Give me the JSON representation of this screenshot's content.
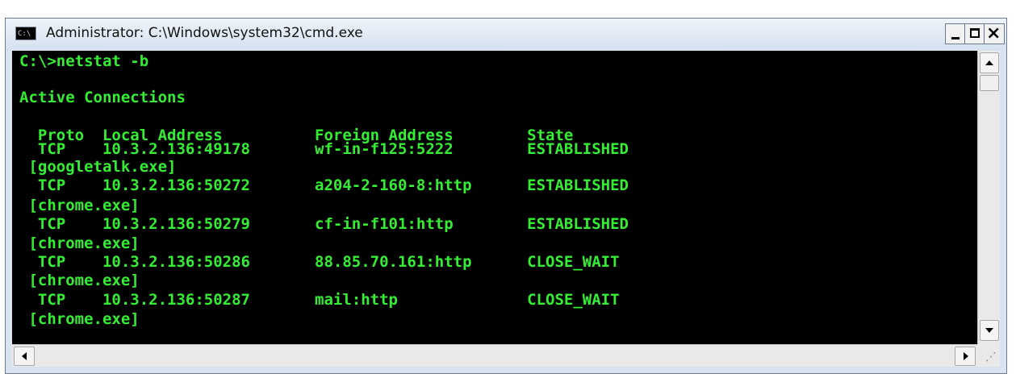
{
  "window": {
    "title": "Administrator: C:\\Windows\\system32\\cmd.exe",
    "icon": "cmd-icon",
    "icon_text": "C:\\"
  },
  "controls": {
    "minimize_icon": "minimize-icon",
    "maximize_icon": "maximize-icon",
    "close_icon": "close-icon",
    "close_glyph": "×"
  },
  "console": {
    "text_color": "#33ee33",
    "background": "#000000",
    "lines": [
      "C:\\>netstat -b",
      "",
      "Active Connections",
      "",
      "  Proto  Local Address          Foreign Address        State",
      "  TCP    10.3.2.136:49178       wf-in-f125:5222        ESTABLISHED",
      " [googletalk.exe]",
      "  TCP    10.3.2.136:50272       a204-2-160-8:http      ESTABLISHED",
      " [chrome.exe]",
      "  TCP    10.3.2.136:50279       cf-in-f101:http        ESTABLISHED",
      " [chrome.exe]",
      "  TCP    10.3.2.136:50286       88.85.70.161:http      CLOSE_WAIT",
      " [chrome.exe]",
      "  TCP    10.3.2.136:50287       mail:http              CLOSE_WAIT",
      " [chrome.exe]"
    ]
  },
  "scrollbars": {
    "up_icon": "arrow-up-icon",
    "down_icon": "arrow-down-icon",
    "left_icon": "arrow-left-icon",
    "right_icon": "arrow-right-icon",
    "grip_icon": "resize-grip-icon",
    "grip_glyph": "⋰"
  }
}
